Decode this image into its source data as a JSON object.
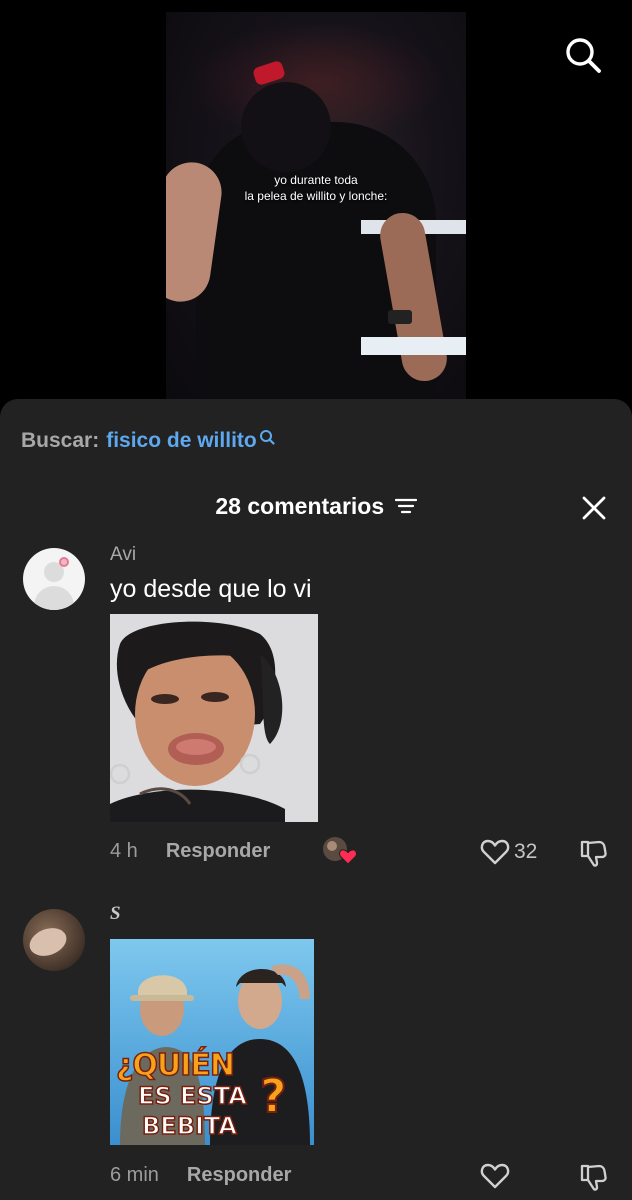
{
  "video": {
    "caption": "yo durante toda\nla pelea de willito y lonche:"
  },
  "top_bar": {
    "search_icon": "search-icon"
  },
  "search_suggestion": {
    "prefix": "Buscar:",
    "query": "fisico de willito"
  },
  "comments_header": {
    "count_label": "28 comentarios",
    "filter_icon": "filter-icon",
    "close_icon": "close-icon"
  },
  "comments": [
    {
      "username": "Avi",
      "text": "yo desde que lo vi",
      "time": "4 h",
      "reply_label": "Responder",
      "likes": "32",
      "liked_by_creator": true
    },
    {
      "username": "S",
      "text": "",
      "image_text": [
        "¿QUIÉN",
        "ES ESTA",
        "BEBITA",
        "?"
      ],
      "time": "6 min",
      "reply_label": "Responder",
      "likes": ""
    }
  ],
  "colors": {
    "sheet_bg": "#222222",
    "link_blue": "#5da8ef",
    "muted": "#a8a8a8",
    "heart_red": "#fe2c55",
    "meme2_text": "#f7a21b"
  }
}
